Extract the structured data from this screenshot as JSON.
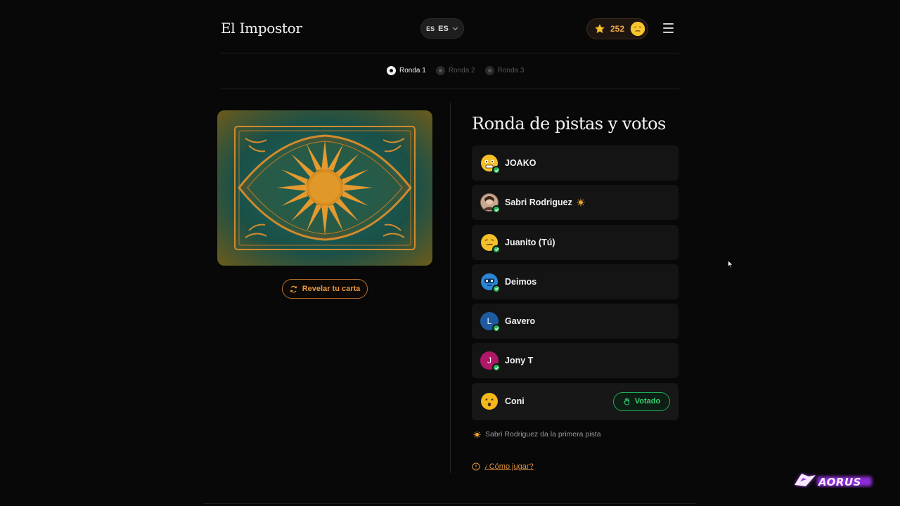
{
  "header": {
    "logo": "El Impostor",
    "language": {
      "flag": "ES",
      "code": "ES"
    },
    "score": "252"
  },
  "rounds": [
    {
      "label": "Ronda 1",
      "active": true
    },
    {
      "label": "Ronda 2",
      "active": false
    },
    {
      "label": "Ronda 3",
      "active": false
    }
  ],
  "card": {
    "reveal_label": "Revelar tu carta"
  },
  "main": {
    "title": "Ronda de pistas y votos",
    "players": [
      {
        "name": "JOAKO",
        "avatar": "emoji-nervous"
      },
      {
        "name": "Sabri Rodriguez",
        "avatar": "photo",
        "starter": true
      },
      {
        "name": "Juanito (Tú)",
        "avatar": "emoji-smirk"
      },
      {
        "name": "Deimos",
        "avatar": "emoji-robot"
      },
      {
        "name": "Gavero",
        "avatar": "letter",
        "initial": "L",
        "color": "#1e5aa0"
      },
      {
        "name": "Jony T",
        "avatar": "letter",
        "initial": "J",
        "color": "#b01766"
      },
      {
        "name": "Coni",
        "avatar": "emoji-surprised",
        "status": "Votado"
      }
    ],
    "hint": "Sabri Rodriguez da la primera pista",
    "how_to": "¿Cómo jugar?"
  },
  "colors": {
    "accent": "#e8963e",
    "voted": "#3bd277",
    "background": "#080808"
  },
  "watermark": "AORUS"
}
